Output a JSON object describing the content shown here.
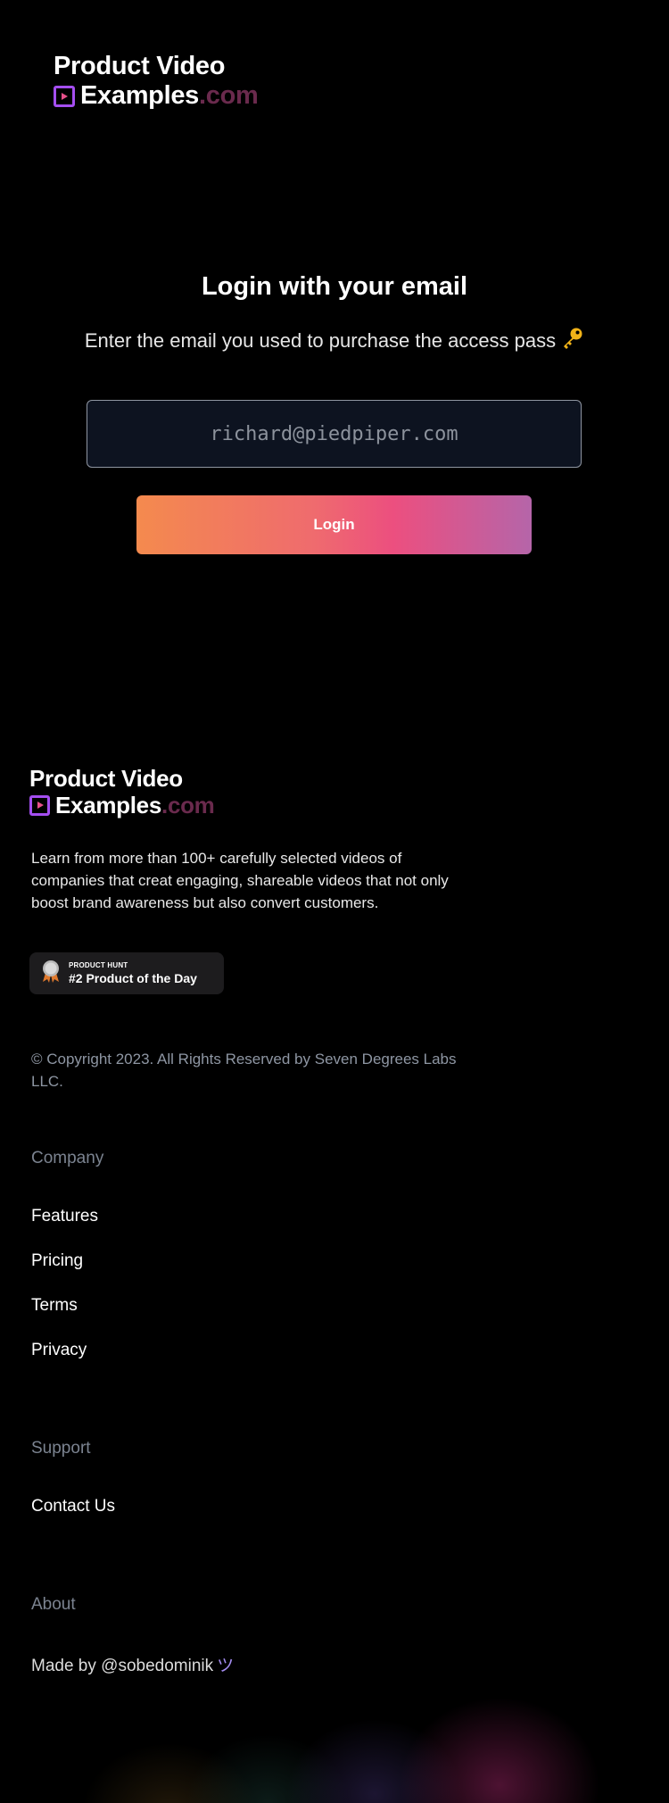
{
  "brand": {
    "line1": "Product Video",
    "line2_main": "Examples",
    "line2_suffix": ".com"
  },
  "login": {
    "title": "Login with your email",
    "subtitle": "Enter the email you used to purchase the access pass",
    "email_placeholder": "richard@piedpiper.com",
    "button_label": "Login"
  },
  "footer": {
    "description": "Learn from more than 100+ carefully selected videos of companies that creat engaging, shareable videos that not only boost brand awareness but also convert customers.",
    "badge": {
      "small": "PRODUCT HUNT",
      "main": "#2 Product of the Day"
    },
    "copyright": "© Copyright 2023. All Rights Reserved by Seven Degrees Labs LLC.",
    "company": {
      "heading": "Company",
      "links": [
        "Features",
        "Pricing",
        "Terms",
        "Privacy"
      ]
    },
    "support": {
      "heading": "Support",
      "links": [
        "Contact Us"
      ]
    },
    "about": {
      "heading": "About",
      "made_by": "Made by @sobedominik",
      "smile": "ツ"
    }
  },
  "colors": {
    "brand_accent": "#a44ef0",
    "com_suffix": "#6a2a4d",
    "button_gradient": [
      "#f48a4e",
      "#ec4f7f",
      "#b565a9"
    ],
    "muted": "#8e96a3"
  }
}
